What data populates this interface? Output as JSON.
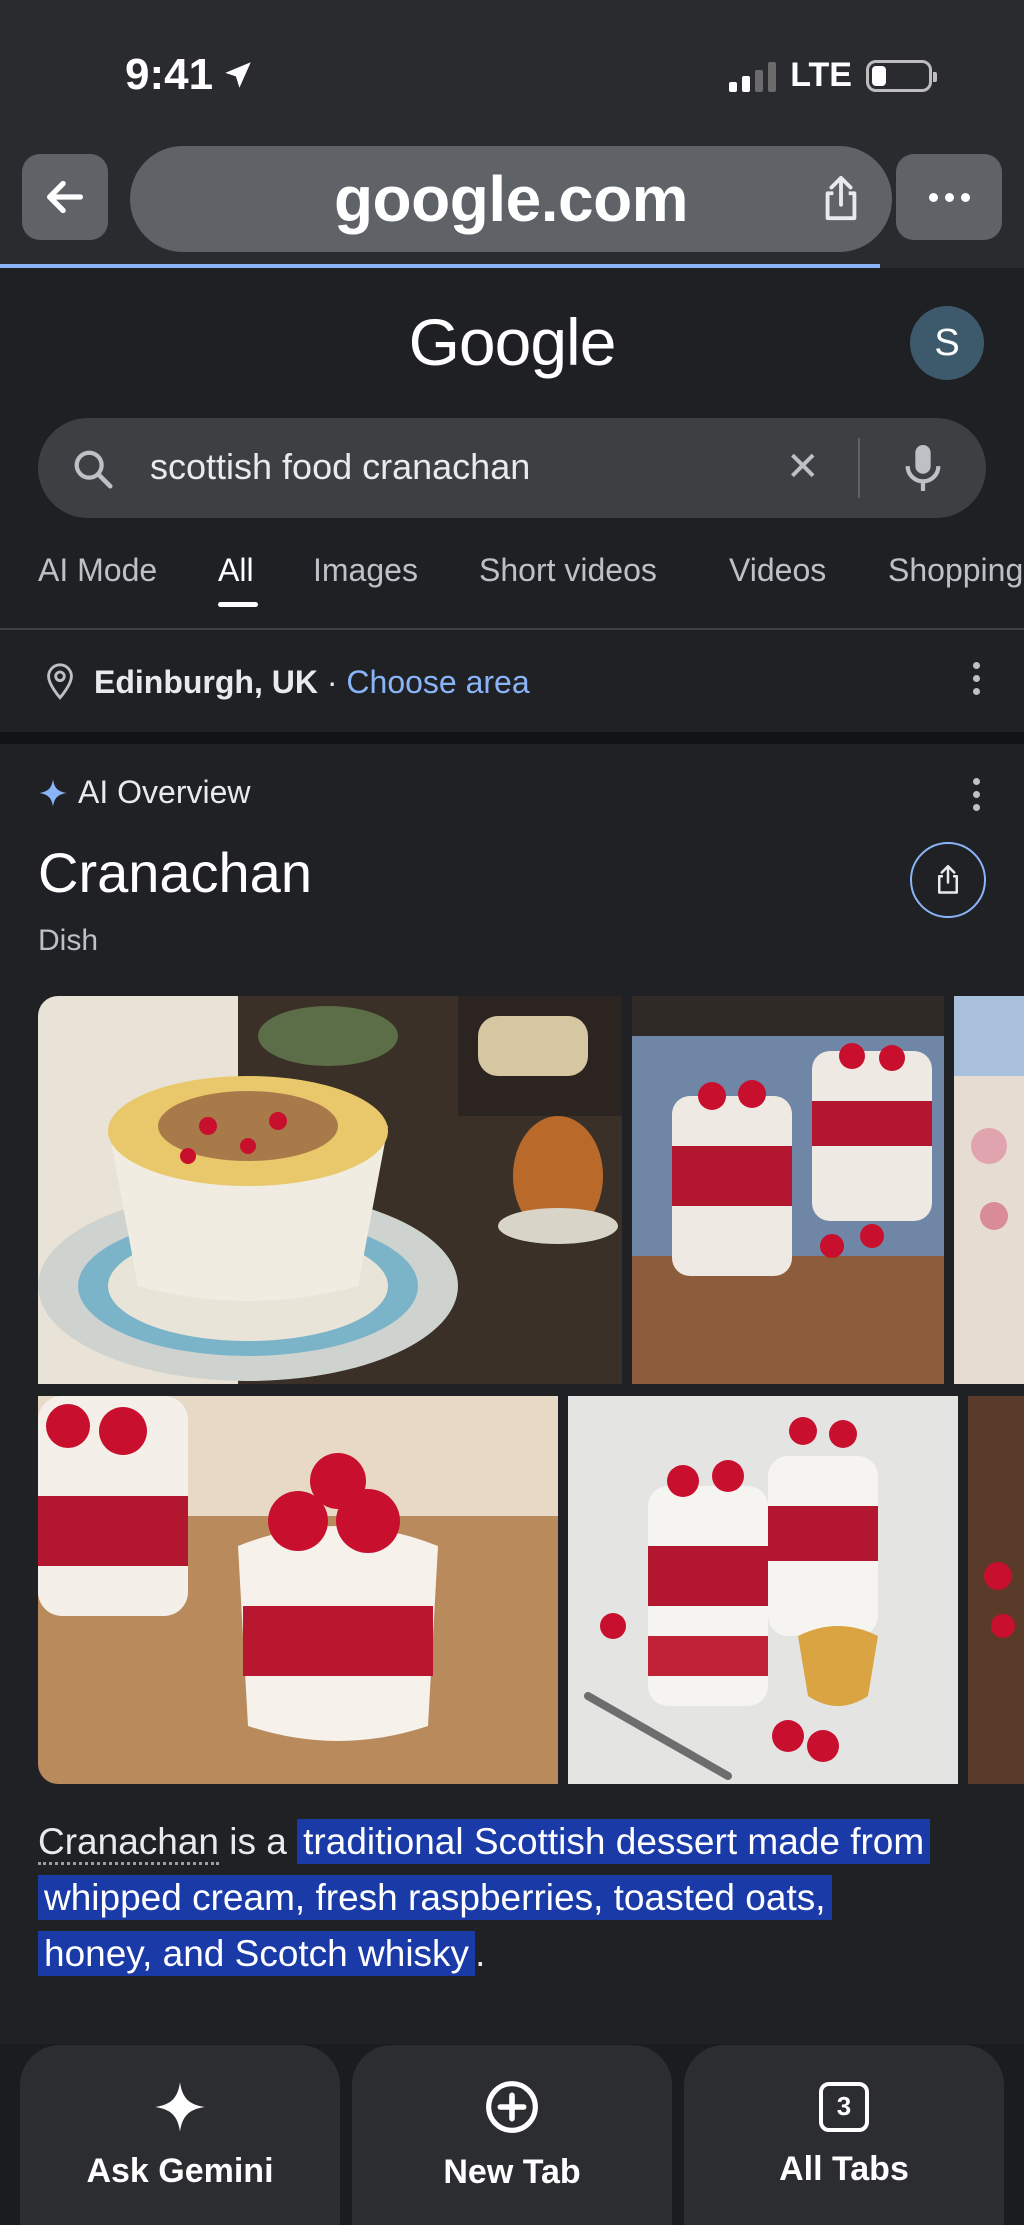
{
  "status_bar": {
    "time": "9:41",
    "network": "LTE"
  },
  "browser": {
    "url": "google.com"
  },
  "google": {
    "logo": "Google",
    "avatar_initial": "S"
  },
  "search": {
    "query": "scottish food cranachan"
  },
  "tabs": [
    {
      "label": "AI Mode"
    },
    {
      "label": "All"
    },
    {
      "label": "Images"
    },
    {
      "label": "Short videos"
    },
    {
      "label": "Videos"
    },
    {
      "label": "Shopping"
    }
  ],
  "location": {
    "place": "Edinburgh, UK",
    "separator": " · ",
    "link": "Choose area"
  },
  "ai_overview": {
    "label": "AI Overview",
    "title": "Cranachan",
    "subtitle": "Dish",
    "text_term": "Cranachan",
    "text_mid": " is a ",
    "text_line1": "traditional Scottish dessert made from",
    "text_line2": "whipped cream, fresh raspberries, toasted oats,",
    "text_line3": "honey, and Scotch whisky",
    "text_end": "."
  },
  "bottom_bar": {
    "ask_gemini": "Ask Gemini",
    "new_tab": "New Tab",
    "all_tabs": "All Tabs",
    "tab_count": "3"
  },
  "colors": {
    "accent": "#8ab4f8",
    "highlight": "#1a3aa8",
    "raspberry": "#c8102e"
  }
}
